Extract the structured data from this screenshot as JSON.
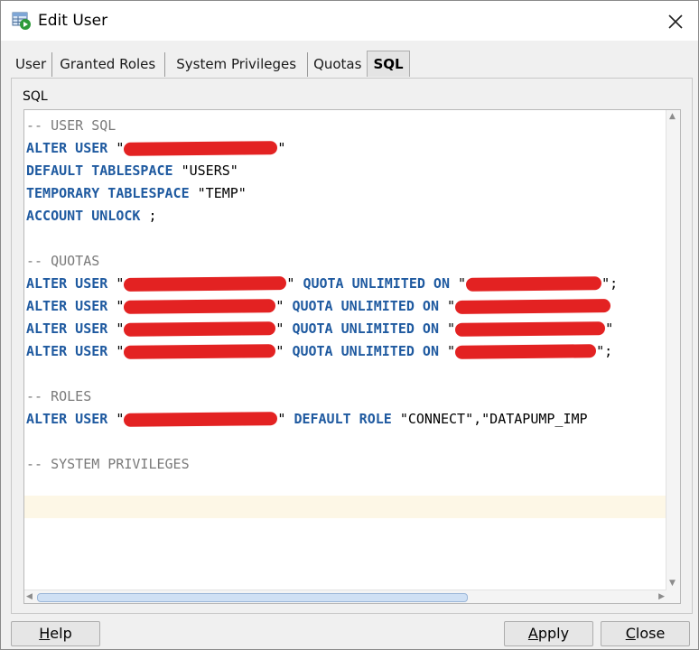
{
  "window": {
    "title": "Edit User"
  },
  "tabs": [
    {
      "label": "User",
      "active": false
    },
    {
      "label": "Granted Roles",
      "active": false
    },
    {
      "label": "System Privileges",
      "active": false
    },
    {
      "label": "Quotas",
      "active": false
    },
    {
      "label": "SQL",
      "active": true
    }
  ],
  "panel": {
    "label": "SQL"
  },
  "code": {
    "lines": [
      [
        {
          "t": "cm",
          "v": "-- USER SQL"
        }
      ],
      [
        {
          "t": "kw",
          "v": "ALTER USER "
        },
        {
          "t": "str",
          "v": "\""
        },
        {
          "t": "red",
          "w": 170
        },
        {
          "t": "str",
          "v": "\""
        }
      ],
      [
        {
          "t": "kw",
          "v": "DEFAULT TABLESPACE "
        },
        {
          "t": "str",
          "v": "\"USERS\""
        }
      ],
      [
        {
          "t": "kw",
          "v": "TEMPORARY TABLESPACE "
        },
        {
          "t": "str",
          "v": "\"TEMP\""
        }
      ],
      [
        {
          "t": "kw",
          "v": "ACCOUNT UNLOCK "
        },
        {
          "t": "str",
          "v": ";"
        }
      ],
      [],
      [
        {
          "t": "cm",
          "v": "-- QUOTAS"
        }
      ],
      [
        {
          "t": "kw",
          "v": "ALTER USER "
        },
        {
          "t": "str",
          "v": "\""
        },
        {
          "t": "red",
          "w": 180
        },
        {
          "t": "str",
          "v": "\" "
        },
        {
          "t": "kw",
          "v": "QUOTA UNLIMITED ON "
        },
        {
          "t": "str",
          "v": "\""
        },
        {
          "t": "red",
          "w": 150
        },
        {
          "t": "str",
          "v": "\";"
        }
      ],
      [
        {
          "t": "kw",
          "v": "ALTER USER "
        },
        {
          "t": "str",
          "v": "\""
        },
        {
          "t": "red",
          "w": 168
        },
        {
          "t": "str",
          "v": "\" "
        },
        {
          "t": "kw",
          "v": "QUOTA UNLIMITED ON "
        },
        {
          "t": "str",
          "v": "\""
        },
        {
          "t": "red",
          "w": 172
        },
        {
          "t": "str",
          "v": ""
        }
      ],
      [
        {
          "t": "kw",
          "v": "ALTER USER "
        },
        {
          "t": "str",
          "v": "\""
        },
        {
          "t": "red",
          "w": 168
        },
        {
          "t": "str",
          "v": "\" "
        },
        {
          "t": "kw",
          "v": "QUOTA UNLIMITED ON "
        },
        {
          "t": "str",
          "v": "\""
        },
        {
          "t": "red",
          "w": 166
        },
        {
          "t": "str",
          "v": "\""
        }
      ],
      [
        {
          "t": "kw",
          "v": "ALTER USER "
        },
        {
          "t": "str",
          "v": "\""
        },
        {
          "t": "red",
          "w": 168
        },
        {
          "t": "str",
          "v": "\" "
        },
        {
          "t": "kw",
          "v": "QUOTA UNLIMITED ON "
        },
        {
          "t": "str",
          "v": "\""
        },
        {
          "t": "red",
          "w": 156
        },
        {
          "t": "str",
          "v": "\";"
        }
      ],
      [],
      [
        {
          "t": "cm",
          "v": "-- ROLES"
        }
      ],
      [
        {
          "t": "kw",
          "v": "ALTER USER "
        },
        {
          "t": "str",
          "v": "\""
        },
        {
          "t": "red",
          "w": 170
        },
        {
          "t": "str",
          "v": "\" "
        },
        {
          "t": "kw",
          "v": "DEFAULT ROLE "
        },
        {
          "t": "str",
          "v": "\"CONNECT\",\"DATAPUMP_IMP"
        }
      ],
      [],
      [
        {
          "t": "cm",
          "v": "-- SYSTEM PRIVILEGES"
        }
      ],
      [],
      []
    ]
  },
  "buttons": {
    "help": {
      "pre": "",
      "ul": "H",
      "post": "elp"
    },
    "apply": {
      "pre": "",
      "ul": "A",
      "post": "pply"
    },
    "close": {
      "pre": "",
      "ul": "C",
      "post": "lose"
    }
  },
  "colors": {
    "keyword": "#1f5aa0",
    "comment": "#7a7a7a",
    "redaction": "#e32222",
    "current_line": "#fdf7e6"
  }
}
